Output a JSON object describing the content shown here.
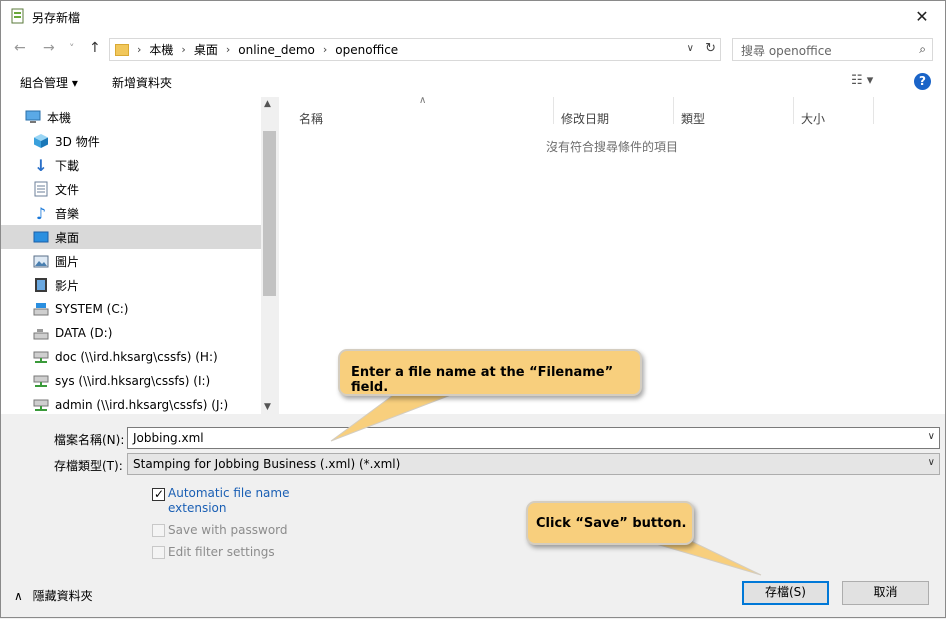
{
  "window": {
    "title": "另存新檔",
    "close_glyph": "✕"
  },
  "nav": {
    "back": "←",
    "forward": "→",
    "recent": "˅",
    "up": "↑",
    "breadcrumbs": [
      "本機",
      "桌面",
      "online_demo",
      "openoffice"
    ],
    "crumb_sep": "›",
    "search_placeholder": "搜尋 openoffice"
  },
  "toolbar": {
    "organize": "組合管理 ▾",
    "new_folder": "新增資料夾",
    "help": "?"
  },
  "sidebar": {
    "items": [
      {
        "label": "本機",
        "icon": "computer-icon"
      },
      {
        "label": "3D 物件",
        "icon": "cube-icon"
      },
      {
        "label": "下載",
        "icon": "download-icon"
      },
      {
        "label": "文件",
        "icon": "document-icon"
      },
      {
        "label": "音樂",
        "icon": "music-icon"
      },
      {
        "label": "桌面",
        "icon": "desktop-icon",
        "selected": true
      },
      {
        "label": "圖片",
        "icon": "picture-icon"
      },
      {
        "label": "影片",
        "icon": "video-icon"
      },
      {
        "label": "SYSTEM (C:)",
        "icon": "drive-icon"
      },
      {
        "label": "DATA (D:)",
        "icon": "drive-icon"
      },
      {
        "label": "doc (\\\\ird.hksarg\\cssfs) (H:)",
        "icon": "network-drive-icon"
      },
      {
        "label": "sys (\\\\ird.hksarg\\cssfs) (I:)",
        "icon": "network-drive-icon"
      },
      {
        "label": "admin (\\\\ird.hksarg\\cssfs) (J:)",
        "icon": "network-drive-icon"
      }
    ]
  },
  "filelist": {
    "columns": [
      "名稱",
      "修改日期",
      "類型",
      "大小"
    ],
    "empty_message": "沒有符合搜尋條件的項目"
  },
  "form": {
    "filename_label": "檔案名稱(N):",
    "filename_value": "Jobbing.xml",
    "filetype_label": "存檔類型(T):",
    "filetype_value": "Stamping for Jobbing Business (.xml) (*.xml)",
    "auto_ext_line1": "Automatic file name",
    "auto_ext_line2": "extension",
    "save_pw": "Save with password",
    "edit_filter": "Edit filter settings"
  },
  "footer": {
    "hide_folders": "隱藏資料夾",
    "save": "存檔(S)",
    "cancel": "取消"
  },
  "callouts": {
    "filename": "Enter a file name at the “Filename” field.",
    "save": "Click “Save” button."
  }
}
